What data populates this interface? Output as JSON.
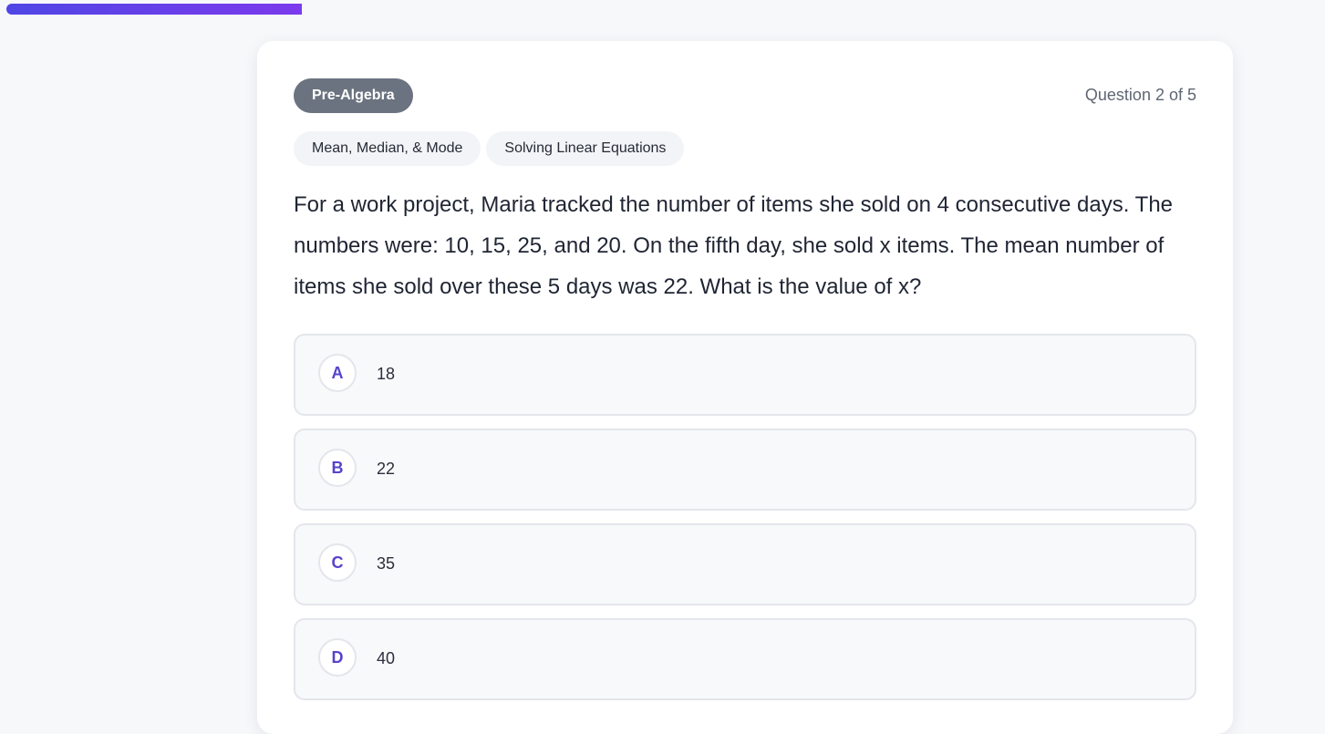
{
  "progress": {
    "fraction": 0.223,
    "color_start": "#4f46e5",
    "color_end": "#7c3aed"
  },
  "header": {
    "subject": "Pre-Algebra",
    "counter": "Question 2 of 5"
  },
  "tags": [
    "Mean, Median, & Mode",
    "Solving Linear Equations"
  ],
  "question": {
    "text": "For a work project, Maria tracked the number of items she sold on 4 consecutive days. The numbers were: 10, 15, 25, and 20. On the fifth day, she sold x items. The mean number of items she sold over these 5 days was 22. What is the value of x?"
  },
  "choices": [
    {
      "letter": "A",
      "text": "18"
    },
    {
      "letter": "B",
      "text": "22"
    },
    {
      "letter": "C",
      "text": "35"
    },
    {
      "letter": "D",
      "text": "40"
    }
  ],
  "colors": {
    "accent": "#5643cc",
    "badge_bg": "#6b7380"
  }
}
